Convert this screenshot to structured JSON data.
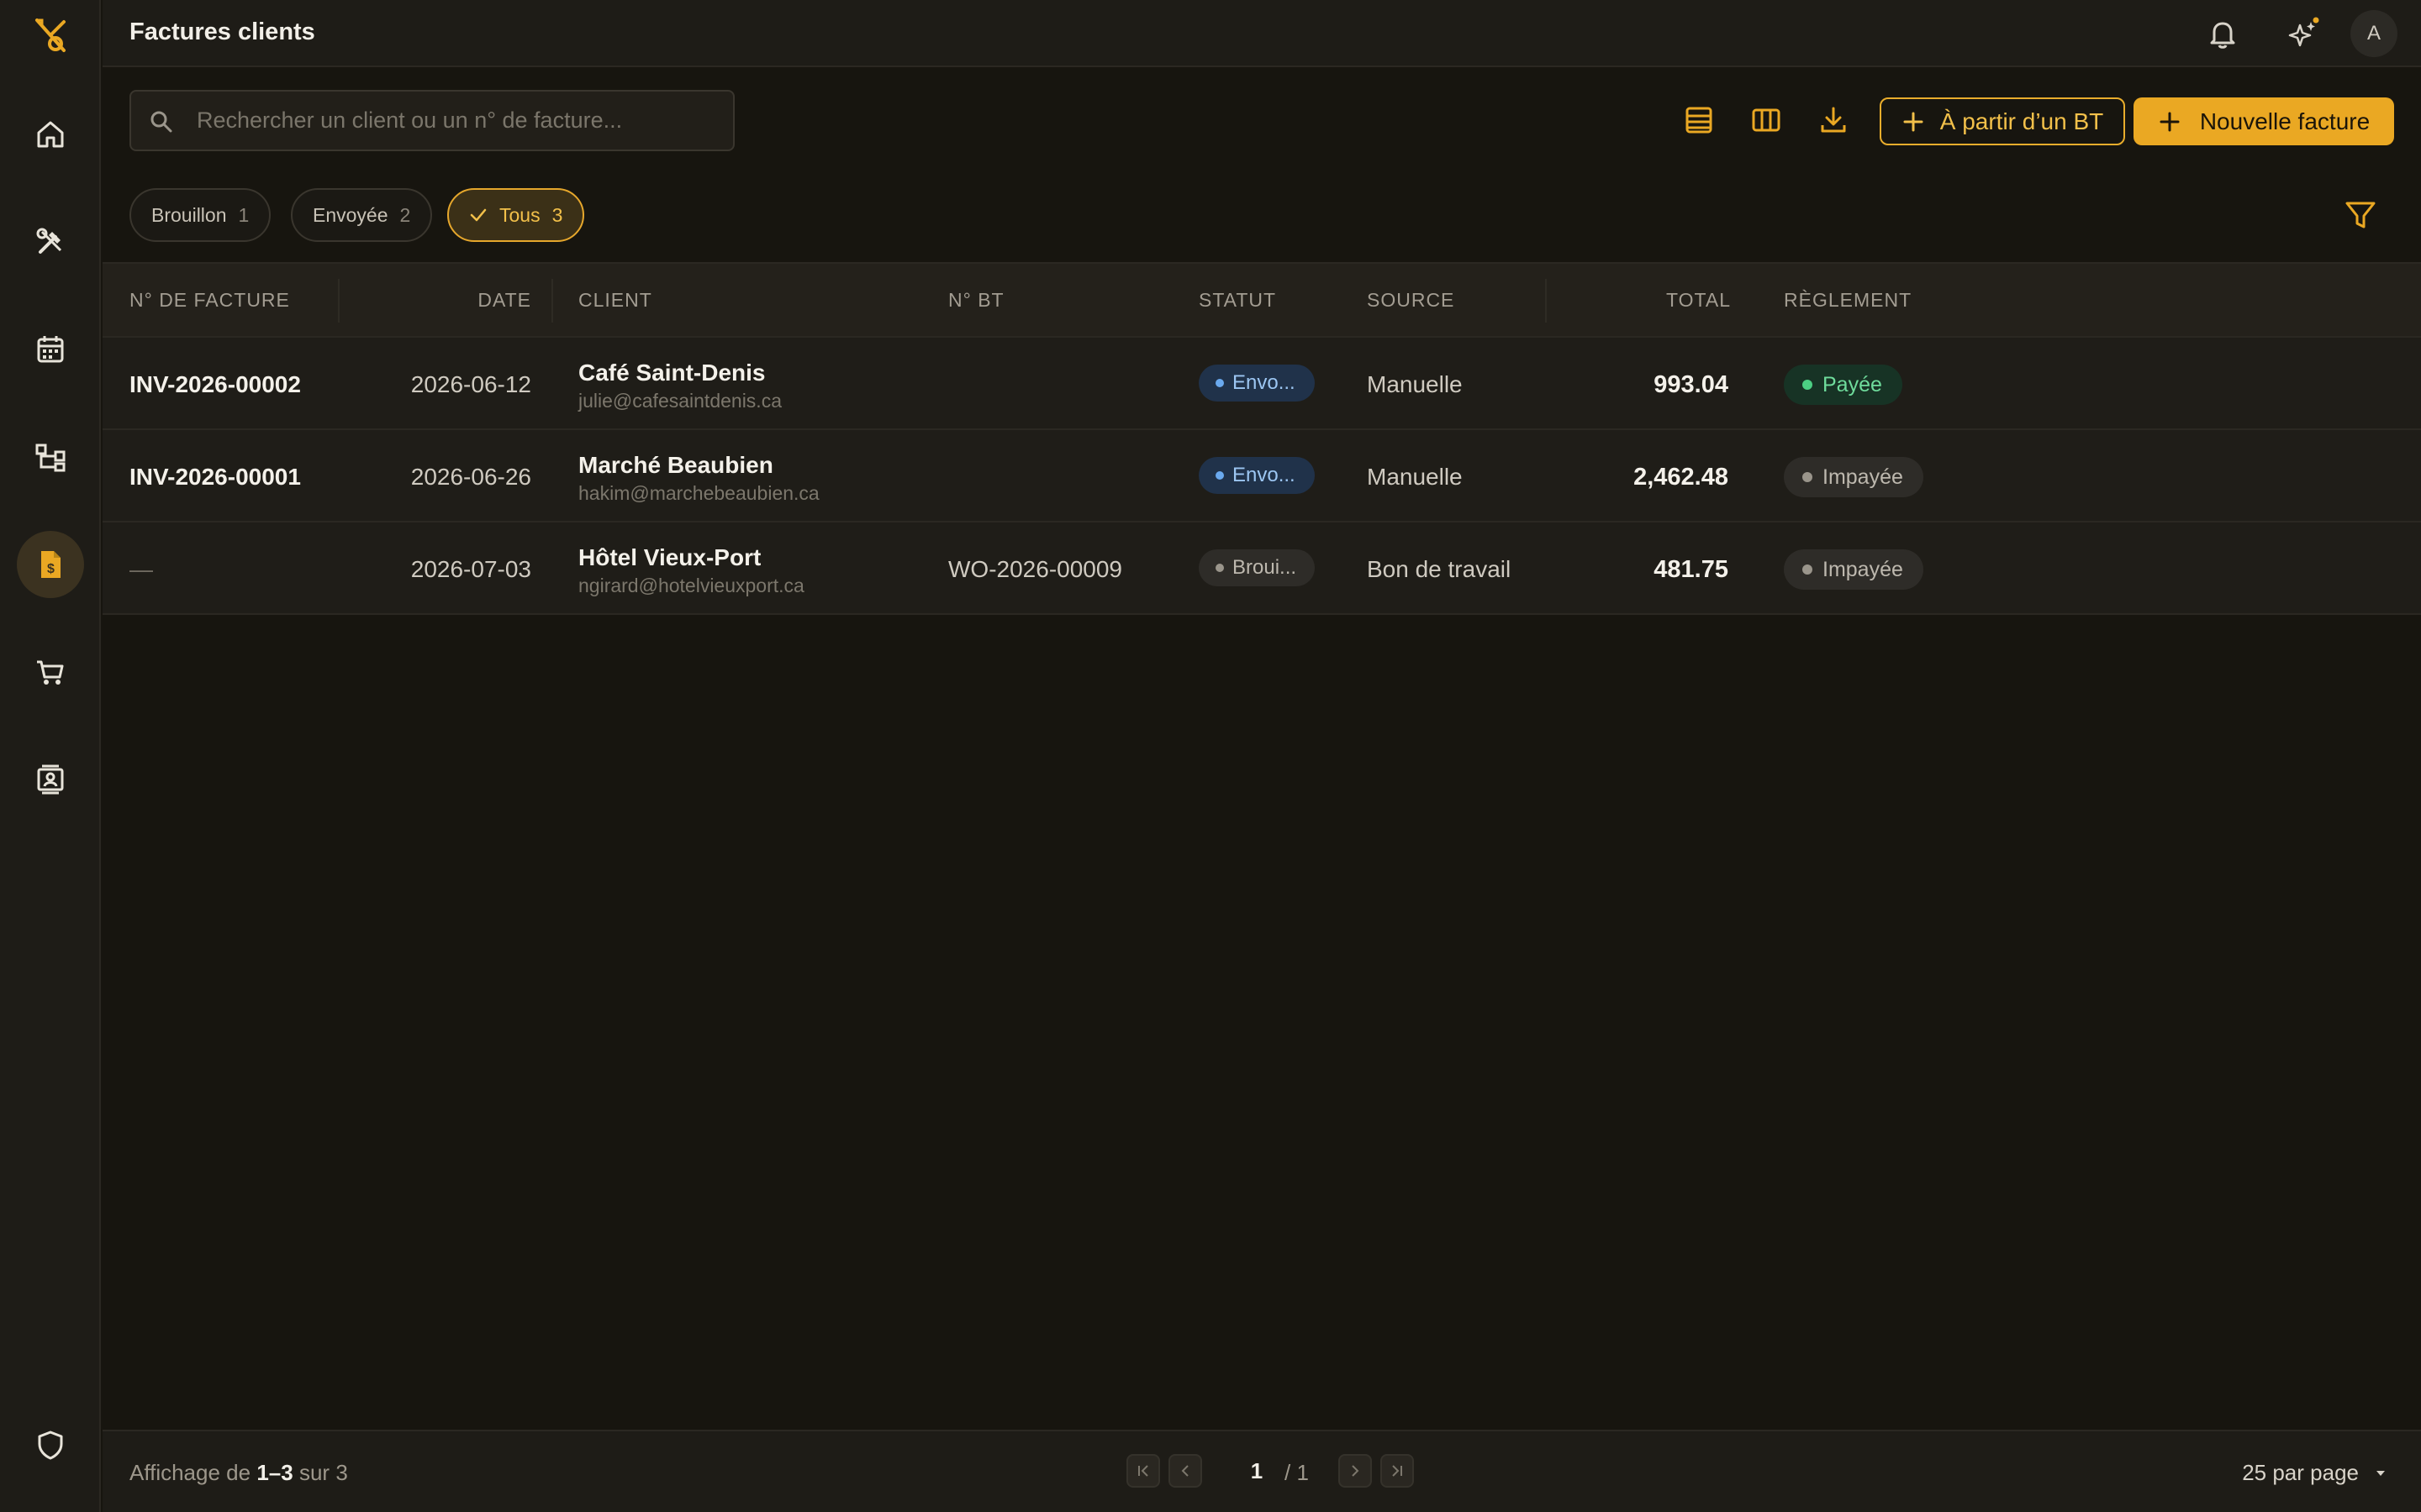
{
  "colors": {
    "accent": "#eaa823",
    "background": "#17150f",
    "sidebar": "#1e1c17",
    "paid": "#4ccf83",
    "sent": "#6aa9ee"
  },
  "sidebar": {
    "logo_icon": "tools-logo-icon",
    "items": [
      {
        "icon": "home-icon",
        "active": false
      },
      {
        "icon": "tools-icon",
        "active": false
      },
      {
        "icon": "calendar-icon",
        "active": false
      },
      {
        "icon": "hierarchy-icon",
        "active": false
      },
      {
        "icon": "invoice-icon",
        "active": true
      },
      {
        "icon": "cart-icon",
        "active": false
      },
      {
        "icon": "contacts-icon",
        "active": false
      }
    ],
    "bottom_icon": "shield-icon"
  },
  "header": {
    "title": "Factures clients",
    "avatar_initial": "A",
    "icons": [
      "bell-icon",
      "sparkles-icon"
    ]
  },
  "toolbar": {
    "search_placeholder": "Rechercher un client ou un n° de facture...",
    "icons": [
      "list-view-icon",
      "columns-icon",
      "download-icon"
    ],
    "from_bt_label": "À partir d’un BT",
    "new_invoice_label": "Nouvelle facture"
  },
  "chips": [
    {
      "label": "Brouillon",
      "count": "1",
      "active": false
    },
    {
      "label": "Envoyée",
      "count": "2",
      "active": false
    },
    {
      "label": "Tous",
      "count": "3",
      "active": true
    }
  ],
  "table": {
    "columns": {
      "invoice": "N° de facture",
      "date": "Date",
      "client": "Client",
      "bt": "N° BT",
      "status": "Statut",
      "source": "Source",
      "total": "Total",
      "payment": "Règlement"
    },
    "rows": [
      {
        "invoice": "INV-2026-00002",
        "date": "2026-06-12",
        "client": "Café Saint-Denis",
        "email": "julie@cafesaintdenis.ca",
        "bt": "",
        "status": "Envo...",
        "source": "Manuelle",
        "total": "993.04",
        "payment": "Payée"
      },
      {
        "invoice": "INV-2026-00001",
        "date": "2026-06-26",
        "client": "Marché Beaubien",
        "email": "hakim@marchebeaubien.ca",
        "bt": "",
        "status": "Envo...",
        "source": "Manuelle",
        "total": "2,462.48",
        "payment": "Impayée"
      },
      {
        "invoice": "—",
        "date": "2026-07-03",
        "client": "Hôtel Vieux-Port",
        "email": "ngirard@hotelvieuxport.ca",
        "bt": "WO-2026-00009",
        "status": "Broui...",
        "source": "Bon de travail",
        "total": "481.75",
        "payment": "Impayée"
      }
    ]
  },
  "footer": {
    "showing_prefix": "Affichage de",
    "showing_range": "1–3",
    "showing_mid": "sur",
    "showing_total": "3",
    "current_page": "1",
    "total_pages": "/ 1",
    "per_page": "25 par page"
  }
}
